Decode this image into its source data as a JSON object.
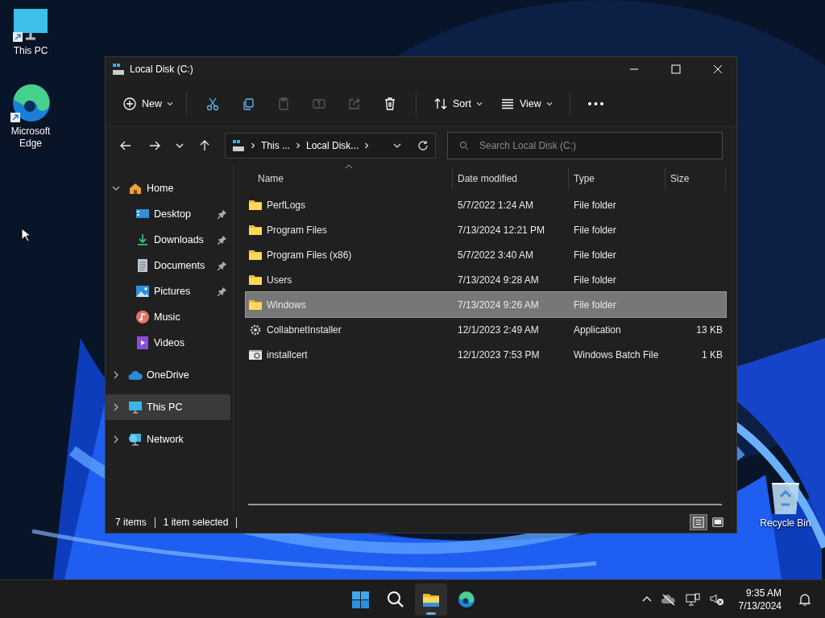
{
  "desktop_icons": [
    {
      "label": "This PC",
      "kind": "pc"
    },
    {
      "label": "Microsoft Edge",
      "kind": "edge"
    },
    {
      "label": "Recycle Bin",
      "kind": "bin"
    }
  ],
  "window": {
    "title": "Local Disk (C:)"
  },
  "toolbar": [
    {
      "kind": "new",
      "label": "New",
      "disabled": false
    },
    {
      "kind": "cut",
      "disabled": false
    },
    {
      "kind": "copy",
      "disabled": false
    },
    {
      "kind": "paste",
      "disabled": true
    },
    {
      "kind": "rename",
      "disabled": true
    },
    {
      "kind": "share",
      "disabled": true
    },
    {
      "kind": "delete",
      "disabled": false
    },
    {
      "kind": "sort",
      "label": "Sort",
      "disabled": false
    },
    {
      "kind": "view",
      "label": "View",
      "disabled": false
    },
    {
      "kind": "more",
      "disabled": false
    }
  ],
  "address": {
    "segments": [
      "This ...",
      "Local Disk..."
    ]
  },
  "search": {
    "placeholder": "Search Local Disk (C:)"
  },
  "sidebar": {
    "items": [
      {
        "label": "Home",
        "kind": "home",
        "expanded": true,
        "selected": false,
        "children": [
          {
            "label": "Desktop",
            "kind": "desktop",
            "pinned": true,
            "selected": false
          },
          {
            "label": "Downloads",
            "kind": "downloads",
            "pinned": true,
            "selected": false
          },
          {
            "label": "Documents",
            "kind": "documents",
            "pinned": true,
            "selected": false
          },
          {
            "label": "Pictures",
            "kind": "pictures",
            "pinned": true,
            "selected": false
          },
          {
            "label": "Music",
            "kind": "music",
            "pinned": false,
            "selected": false
          },
          {
            "label": "Videos",
            "kind": "videos",
            "pinned": false,
            "selected": false
          }
        ]
      },
      {
        "label": "OneDrive",
        "kind": "onedrive",
        "expanded": false,
        "selected": false
      },
      {
        "label": "This PC",
        "kind": "pc",
        "expanded": false,
        "selected": true
      },
      {
        "label": "Network",
        "kind": "network",
        "expanded": false,
        "selected": false
      }
    ]
  },
  "table": {
    "columns": [
      {
        "label": "Name",
        "sorted": true
      },
      {
        "label": "Date modified",
        "sorted": false
      },
      {
        "label": "Type",
        "sorted": false
      },
      {
        "label": "Size",
        "sorted": false
      }
    ],
    "rows": [
      {
        "name": "PerfLogs",
        "date": "5/7/2022 1:24 AM",
        "type": "File folder",
        "kind": "folder",
        "selected": false
      },
      {
        "name": "Program Files",
        "date": "7/13/2024 12:21 PM",
        "type": "File folder",
        "kind": "folder",
        "selected": false
      },
      {
        "name": "Program Files (x86)",
        "date": "5/7/2022 3:40 AM",
        "type": "File folder",
        "kind": "folder",
        "selected": false
      },
      {
        "name": "Users",
        "date": "7/13/2024 9:28 AM",
        "type": "File folder",
        "kind": "folder",
        "selected": false
      },
      {
        "name": "Windows",
        "date": "7/13/2024 9:26 AM",
        "type": "File folder",
        "kind": "folder",
        "selected": true
      },
      {
        "name": "CollabnetInstaller",
        "date": "12/1/2023 2:49 AM",
        "type": "Application",
        "size": "13 KB",
        "kind": "app",
        "selected": false
      },
      {
        "name": "installcert",
        "date": "12/1/2023 7:53 PM",
        "type": "Windows Batch File",
        "size": "1 KB",
        "kind": "batch",
        "selected": false
      }
    ]
  },
  "status_bar": {
    "count": "7 items",
    "selection": "1 item selected",
    "views": [
      {
        "kind": "details",
        "selected": true
      },
      {
        "kind": "tiles",
        "selected": false
      }
    ]
  },
  "taskbar": {
    "apps": [
      {
        "kind": "start",
        "active": false
      },
      {
        "kind": "search",
        "active": false
      },
      {
        "kind": "explorer",
        "active": true
      },
      {
        "kind": "edge",
        "active": false
      }
    ],
    "time": "9:35 AM",
    "date": "7/13/2024"
  }
}
